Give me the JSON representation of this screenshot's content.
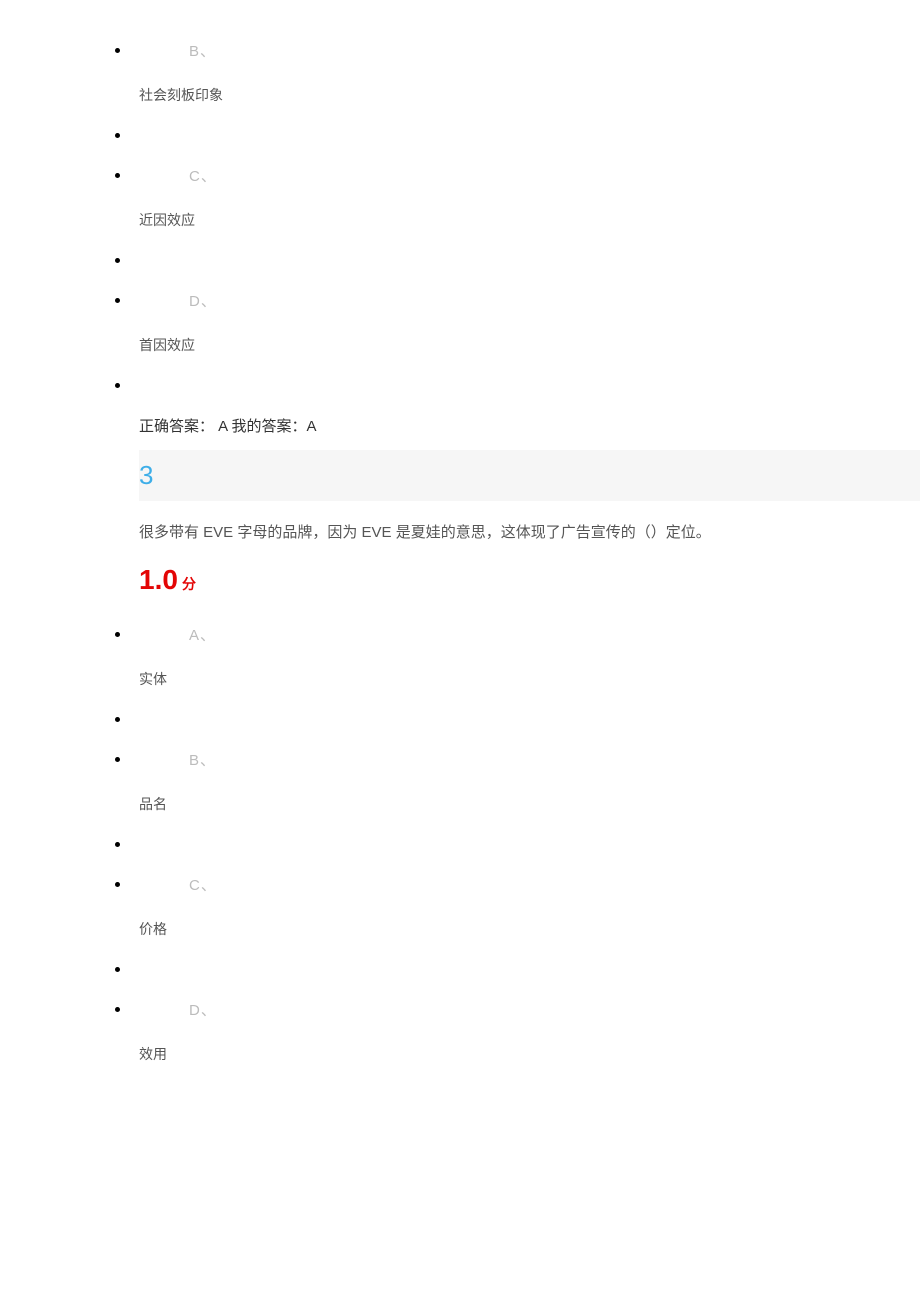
{
  "prev_options": [
    {
      "letter": "B、",
      "text": "社会刻板印象"
    },
    {
      "letter": "C、",
      "text": "近因效应"
    },
    {
      "letter": "D、",
      "text": "首因效应"
    }
  ],
  "answer": {
    "correct_prefix": "正确答案：",
    "correct_value": " A ",
    "my_prefix": "我的答案：",
    "my_value": "A"
  },
  "question": {
    "number": "3",
    "text": "很多带有 EVE 字母的品牌，因为 EVE 是夏娃的意思，这体现了广告宣传的（）定位。"
  },
  "score": {
    "value": "1.0",
    "unit": "分"
  },
  "options": [
    {
      "letter": "A、",
      "text": "实体"
    },
    {
      "letter": "B、",
      "text": "品名"
    },
    {
      "letter": "C、",
      "text": "价格"
    },
    {
      "letter": "D、",
      "text": "效用"
    }
  ]
}
